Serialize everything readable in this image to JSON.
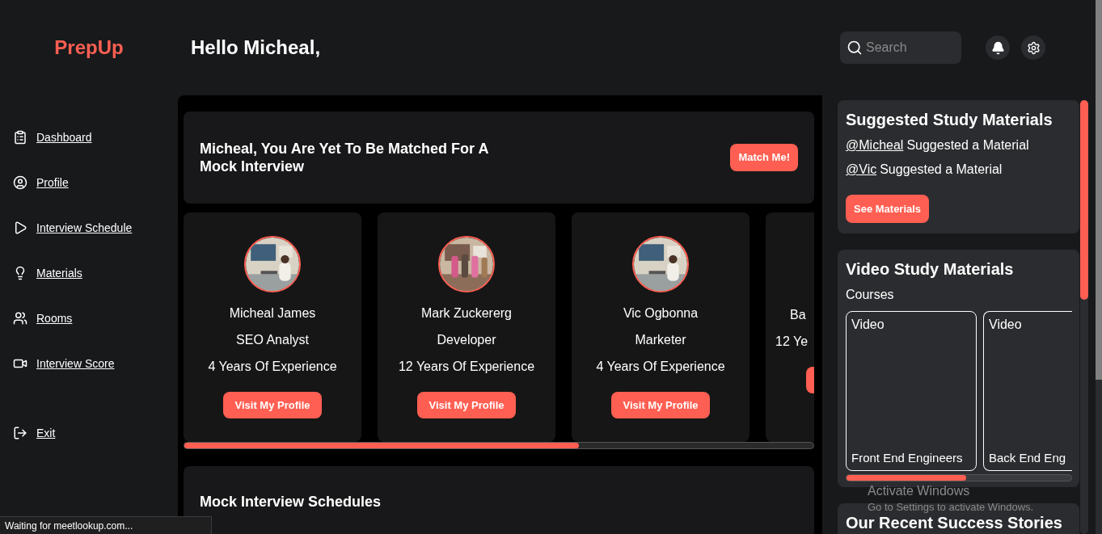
{
  "brand": "PrepUp",
  "greeting": "Hello Micheal,",
  "search": {
    "placeholder": "Search"
  },
  "sidebar": {
    "items": [
      {
        "label": "Dashboard",
        "kind": "clipboard"
      },
      {
        "label": "Profile",
        "kind": "user"
      },
      {
        "label": "Interview Schedule",
        "kind": "play"
      },
      {
        "label": "Materials",
        "kind": "bulb"
      },
      {
        "label": "Rooms",
        "kind": "rooms"
      },
      {
        "label": "Interview Score",
        "kind": "video"
      }
    ],
    "exit": "Exit"
  },
  "match_banner": {
    "text": "Micheal, You Are Yet To Be Matched For A Mock Interview",
    "button": "Match Me!"
  },
  "profiles": [
    {
      "name": "Micheal James",
      "role": "SEO Analyst",
      "experience": "4 Years Of Experience",
      "button": "Visit My Profile"
    },
    {
      "name": "Mark Zuckererg",
      "role": "Developer",
      "experience": "12 Years Of Experience",
      "button": "Visit My Profile"
    },
    {
      "name": "Vic Ogbonna",
      "role": "Marketer",
      "experience": "4 Years Of Experience",
      "button": "Visit My Profile"
    }
  ],
  "partial_profile": {
    "role": "Ba",
    "experience": "12 Ye"
  },
  "schedules": {
    "title": "Mock Interview Schedules"
  },
  "suggested": {
    "title": "Suggested Study Materials",
    "items": [
      {
        "user": "@Micheal",
        "text": "Suggested a Material"
      },
      {
        "user": "@Vic",
        "text": "Suggested a Material"
      }
    ],
    "button": "See Materials"
  },
  "videos": {
    "title": "Video Study Materials",
    "subtitle": "Courses",
    "items": [
      {
        "label": "Video",
        "caption": "Front End Engineers"
      },
      {
        "label": "Video",
        "caption": "Back End Eng"
      }
    ]
  },
  "success": {
    "title": "Our Recent Success Stories"
  },
  "status_bar": "Waiting for meetlookup.com...",
  "os_notice": {
    "title": "Activate Windows",
    "text": "Go to Settings to activate Windows."
  }
}
